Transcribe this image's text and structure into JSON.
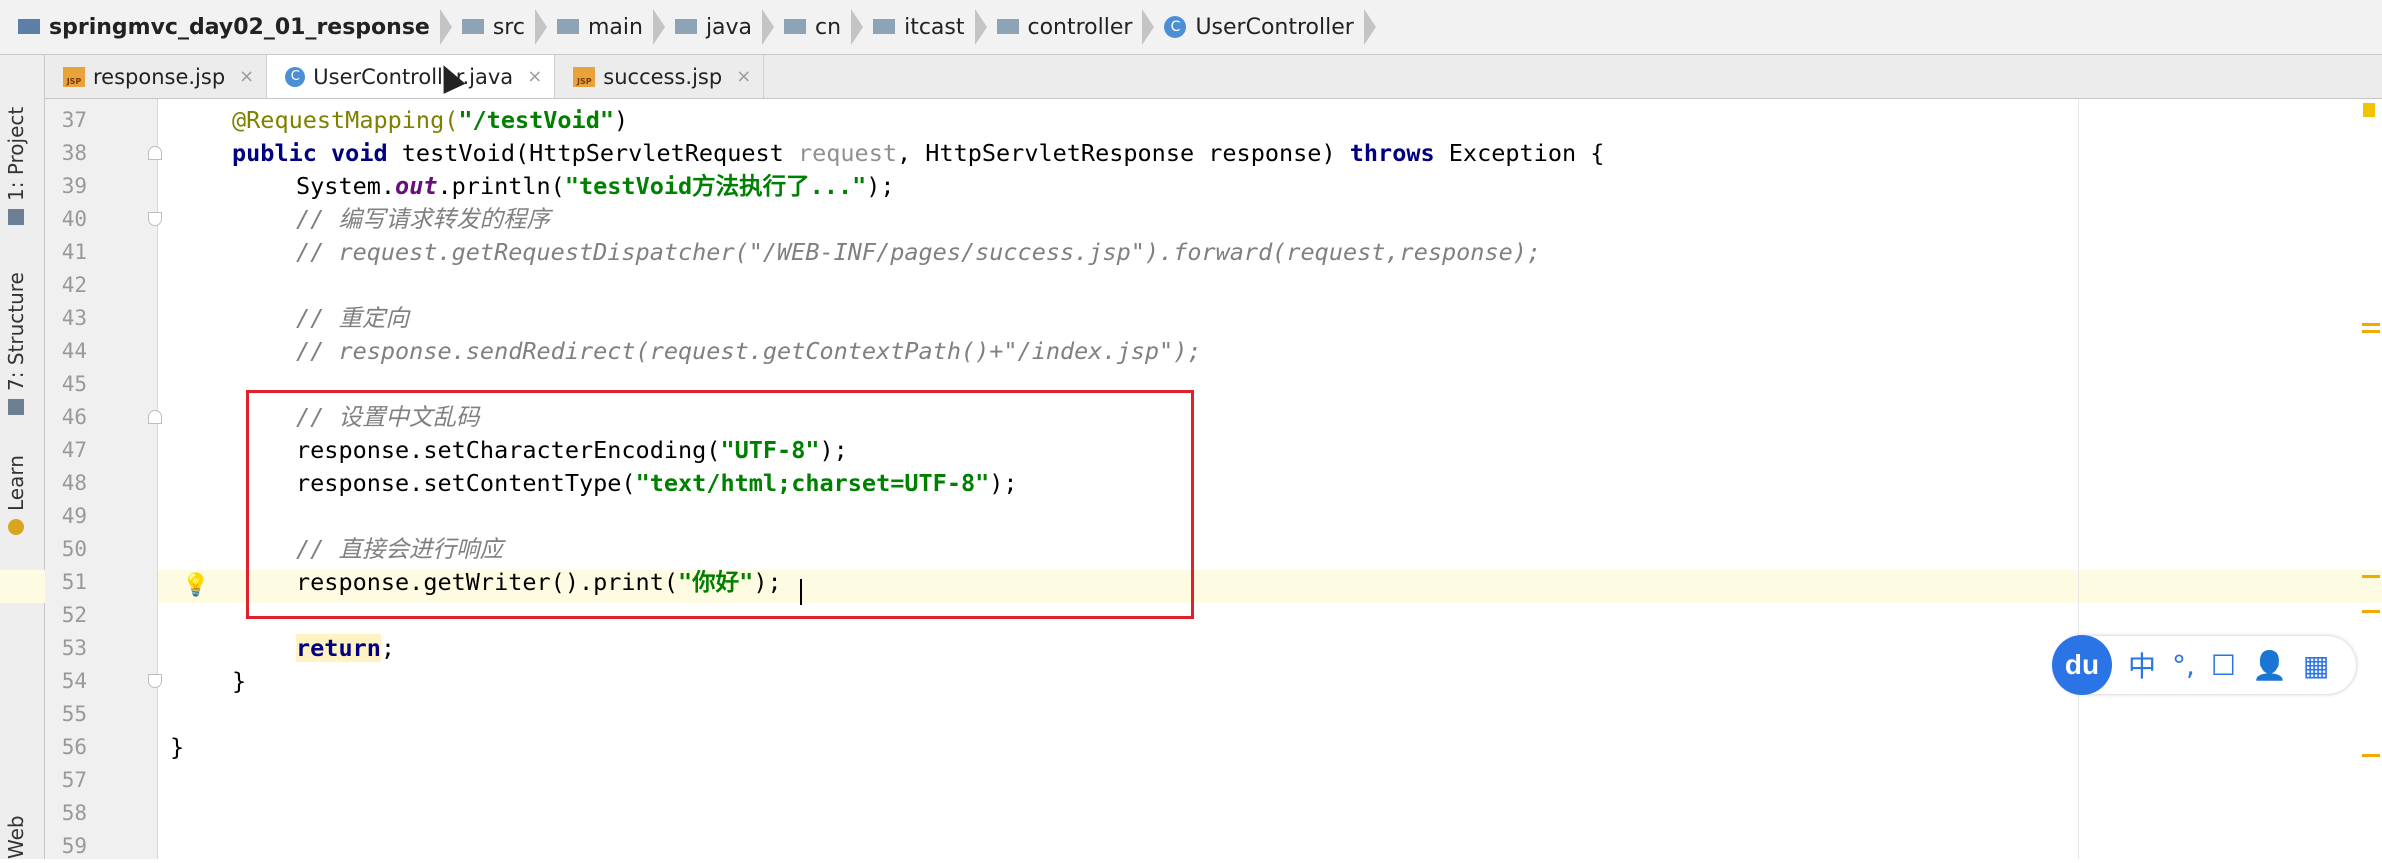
{
  "breadcrumb": [
    {
      "label": "springmvc_day02_01_response",
      "icon": "project-folder-icon"
    },
    {
      "label": "src",
      "icon": "folder-icon"
    },
    {
      "label": "main",
      "icon": "folder-icon"
    },
    {
      "label": "java",
      "icon": "folder-icon"
    },
    {
      "label": "cn",
      "icon": "folder-icon"
    },
    {
      "label": "itcast",
      "icon": "folder-icon"
    },
    {
      "label": "controller",
      "icon": "folder-icon"
    },
    {
      "label": "UserController",
      "icon": "class-icon"
    }
  ],
  "toolstrip": {
    "project": "1: Project",
    "structure": "7: Structure",
    "learn": "Learn",
    "web": "Web"
  },
  "tabs": [
    {
      "label": "response.jsp",
      "icon": "jsp-icon",
      "active": false
    },
    {
      "label": "UserController.java",
      "icon": "class-icon",
      "active": true
    },
    {
      "label": "success.jsp",
      "icon": "jsp-icon",
      "active": false
    }
  ],
  "editor": {
    "line_numbers": [
      "37",
      "38",
      "39",
      "40",
      "41",
      "42",
      "43",
      "44",
      "45",
      "46",
      "47",
      "48",
      "49",
      "50",
      "51",
      "52",
      "53",
      "54",
      "55",
      "56",
      "57",
      "58",
      "59"
    ],
    "code": {
      "l37_ann": "@RequestMapping(",
      "l37_str": "\"/testVoid\"",
      "l37_end": ")",
      "l38_kw1": "public void",
      "l38_a": " testVoid(HttpServletRequest ",
      "l38_unused": "request",
      "l38_b": ", HttpServletResponse response) ",
      "l38_kw2": "throws",
      "l38_c": " Exception {",
      "l39_a": "System.",
      "l39_fld": "out",
      "l39_b": ".println(",
      "l39_str": "\"testVoid方法执行了...\"",
      "l39_c": ");",
      "l40_cmt": "// 编写请求转发的程序",
      "l41_cmt": "// request.getRequestDispatcher(\"/WEB-INF/pages/success.jsp\").forward(request,response);",
      "l43_cmt": "// 重定向",
      "l44_cmt": "// response.sendRedirect(request.getContextPath()+\"/index.jsp\");",
      "l46_cmt": "// 设置中文乱码",
      "l47_a": "response.setCharacterEncoding(",
      "l47_str": "\"UTF-8\"",
      "l47_b": ");",
      "l48_a": "response.setContentType(",
      "l48_str": "\"text/html;charset=UTF-8\"",
      "l48_b": ");",
      "l50_cmt": "// 直接会进行响应",
      "l51_a": "response.getWriter().print(",
      "l51_str": "\"你好\"",
      "l51_b": ");",
      "l53_kw": "return",
      "l53_b": ";",
      "l54": "}",
      "l56": "}"
    }
  },
  "ime": {
    "logo": "du",
    "items": [
      "中",
      "°,",
      "☐",
      "👤",
      "▦"
    ]
  },
  "colors": {
    "keyword": "#000080",
    "string": "#008000",
    "comment": "#808080",
    "annotation": "#808000",
    "highlight_box": "#e0202a",
    "ime_blue": "#2a74e6"
  }
}
